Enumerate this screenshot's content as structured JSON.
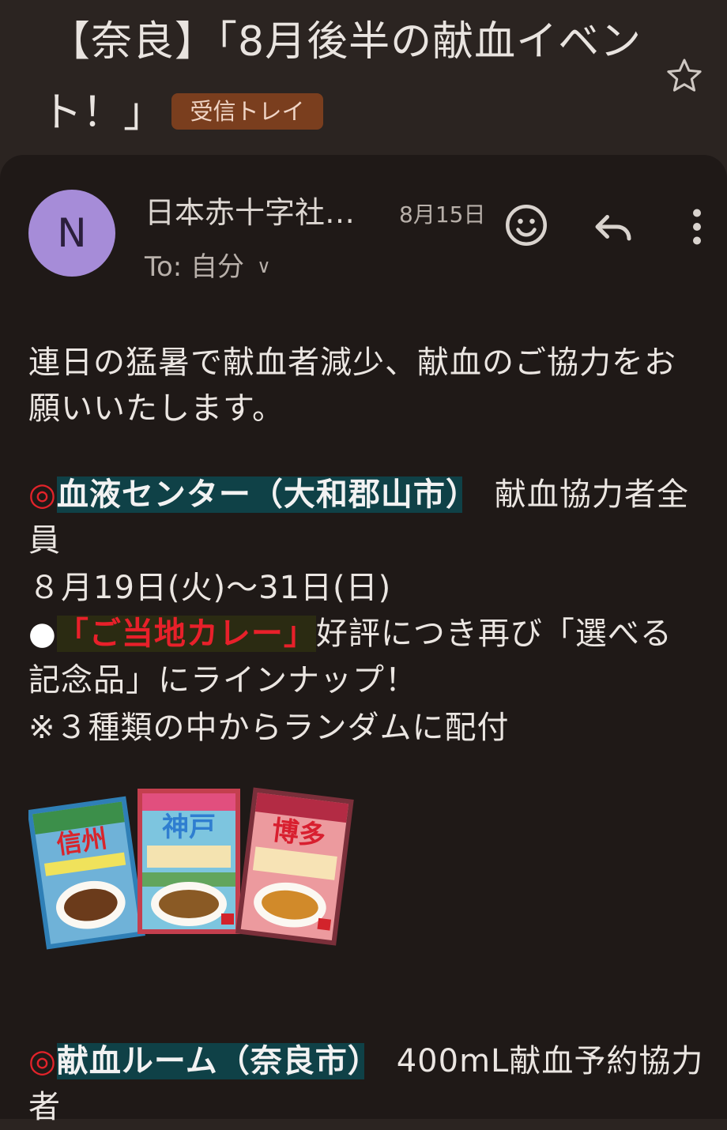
{
  "subject": {
    "line1": "【奈良】「8月後半の献血イベン",
    "line2": "ト！」",
    "label_chip": "受信トレイ"
  },
  "header": {
    "avatar_letter": "N",
    "sender": "日本赤十字社…",
    "date": "8月15日",
    "to": "To: 自分"
  },
  "body": {
    "p1_line1": "連日の猛暑で献血者減少、献血のご協力をお",
    "p1_line2": "願いいたします。",
    "sec1_mark": "◎",
    "sec1_title": "血液センター（大和郡山市）",
    "sec1_rest": "　献血協力者全",
    "sec1_line2": "員",
    "sec1_dates": " ８月19日(火)〜31日(日)",
    "bullet": "●",
    "curry_label": "「ご当地カレー」",
    "curry_rest": "好評につき再び「選べる",
    "curry_line2": "記念品」にラインナップ！",
    "note": "※３種類の中からランダムに配付",
    "curry_names": [
      "信州",
      "神戸",
      "博多"
    ],
    "sec2_mark": "◎",
    "sec2_title": "献血ルーム（奈良市）",
    "sec2_rest": "　400mL献血予約協力",
    "sec2_line2": "者"
  },
  "colors": {
    "background": "#2b2421",
    "card": "#1f1917",
    "avatar": "#a68cd8",
    "chip": "#7a3e1e",
    "highlight_teal": "#0f4147",
    "accent_red": "#e2232a"
  }
}
